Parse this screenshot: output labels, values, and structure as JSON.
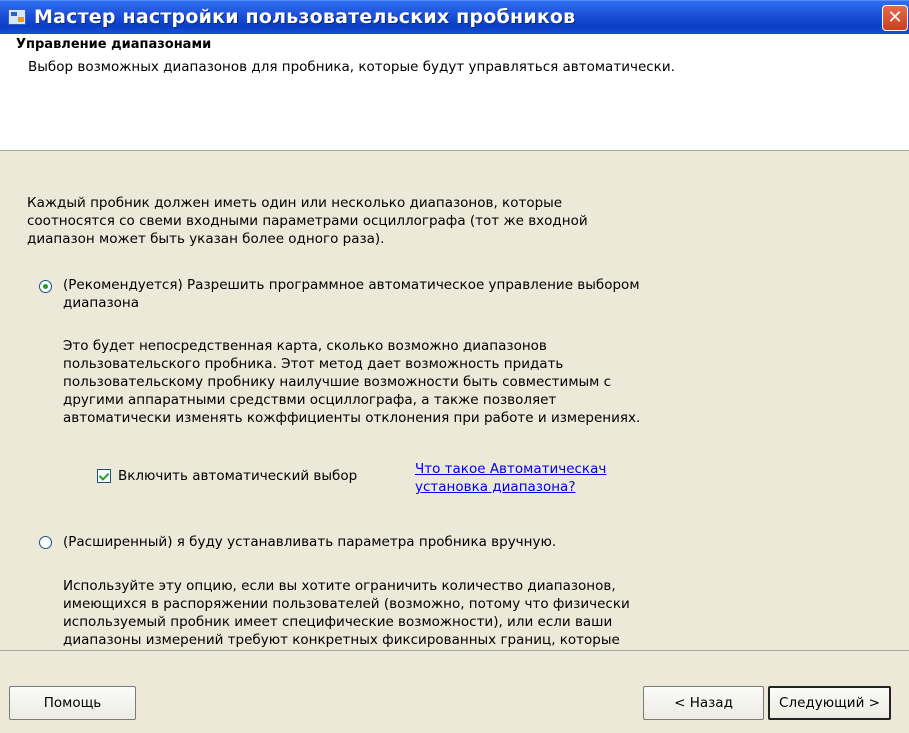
{
  "window": {
    "title": "Мастер настройки пользовательских пробников",
    "app_icon": "wizard-app-icon",
    "close_icon": "close-icon",
    "close_glyph": "✕"
  },
  "header": {
    "title": "Управление диапазонами",
    "subtitle": "Выбор возможных диапазонов для пробника, которые будут управляться автоматически."
  },
  "intro": {
    "line1": "Каждый пробник должен иметь один или несколько диапазонов, которые",
    "line2": "соотносятся со свеми входными параметрами осциллографа (тот же входной",
    "line3": "диапазон может быть указан более одного раза)."
  },
  "option_recommended": {
    "selected": true,
    "label_line1": "(Рекомендуется) Разрешить программное автоматическое управление  выбором",
    "label_line2": "диапазона",
    "desc_line1": "Это будет непосредственная карта, сколько возможно диапазонов",
    "desc_line2": "пользовательского пробника. Этот метод дает возможность придать",
    "desc_line3": "пользовательскому пробнику наилучшие возможности быть совместимым с",
    "desc_line4": "другими аппаратными средствми осциллографа, а также позволяет",
    "desc_line5": "автоматически изменять кожффициенты отклонения при работе и измерениях."
  },
  "auto_select": {
    "checked": true,
    "label": "Включить автоматический выбор",
    "link_line1": "Что такое Автоматическач",
    "link_line2": "установка диапазона?"
  },
  "option_advanced": {
    "selected": false,
    "label": "(Расширенный) я буду устанавливать параметра пробника вручную.",
    "desc_line1": "Используйте эту опцию, если вы хотите ограничить количество диапазонов,",
    "desc_line2": "имеющихся в распоряжении пользователей (возможно, потому что физически",
    "desc_line3": "используемый пробник имеет специфические возможности), или если ваши",
    "desc_line4": "диапазоны измерений требуют конкретных фиксированных границ, которые"
  },
  "footer": {
    "help_label": "Помощь",
    "back_label": "< Назад",
    "next_label": "Следующий >"
  }
}
